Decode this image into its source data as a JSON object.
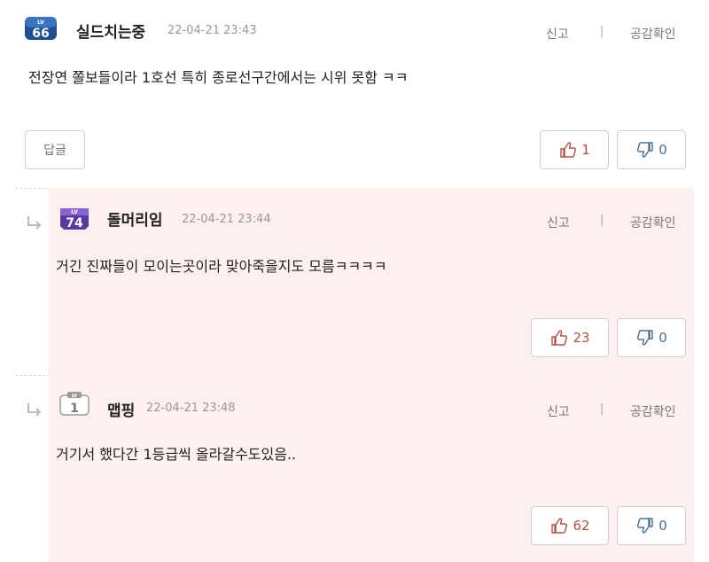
{
  "comments": [
    {
      "level": "66",
      "nickname": "실드치는중",
      "date": "22-04-21 23:43",
      "report": "신고",
      "separator": "|",
      "agree": "공감확인",
      "text": "전장연 쫄보들이라 1호선 특히 종로선구간에서는 시위 못함 ㅋㅋ",
      "reply_label": "답글",
      "likes": "1",
      "dislikes": "0",
      "badge_color": "#1f4f8f"
    },
    {
      "level": "74",
      "nickname": "돌머리임",
      "date": "22-04-21 23:44",
      "report": "신고",
      "separator": "|",
      "agree": "공감확인",
      "text": "거긴 진짜들이 모이는곳이라 맞아죽을지도 모름ㅋㅋㅋㅋ",
      "likes": "23",
      "dislikes": "0",
      "badge_color": "#5a3aa0"
    },
    {
      "level": "1",
      "nickname": "맵핑",
      "date": "22-04-21 23:48",
      "report": "신고",
      "separator": "|",
      "agree": "공감확인",
      "text": "거기서 했다간 1등급씩 올라갈수도있음..",
      "likes": "62",
      "dislikes": "0",
      "badge_color": "#9a9a9a"
    }
  ],
  "badge_prefix": "LV",
  "icons": {
    "like": "thumbs-up-icon",
    "dislike": "thumbs-down-icon",
    "reply_arrow": "reply-arrow-icon"
  },
  "colors": {
    "reply_background": "#fdf1ef",
    "like": "#b35046",
    "dislike": "#4b6e96"
  }
}
